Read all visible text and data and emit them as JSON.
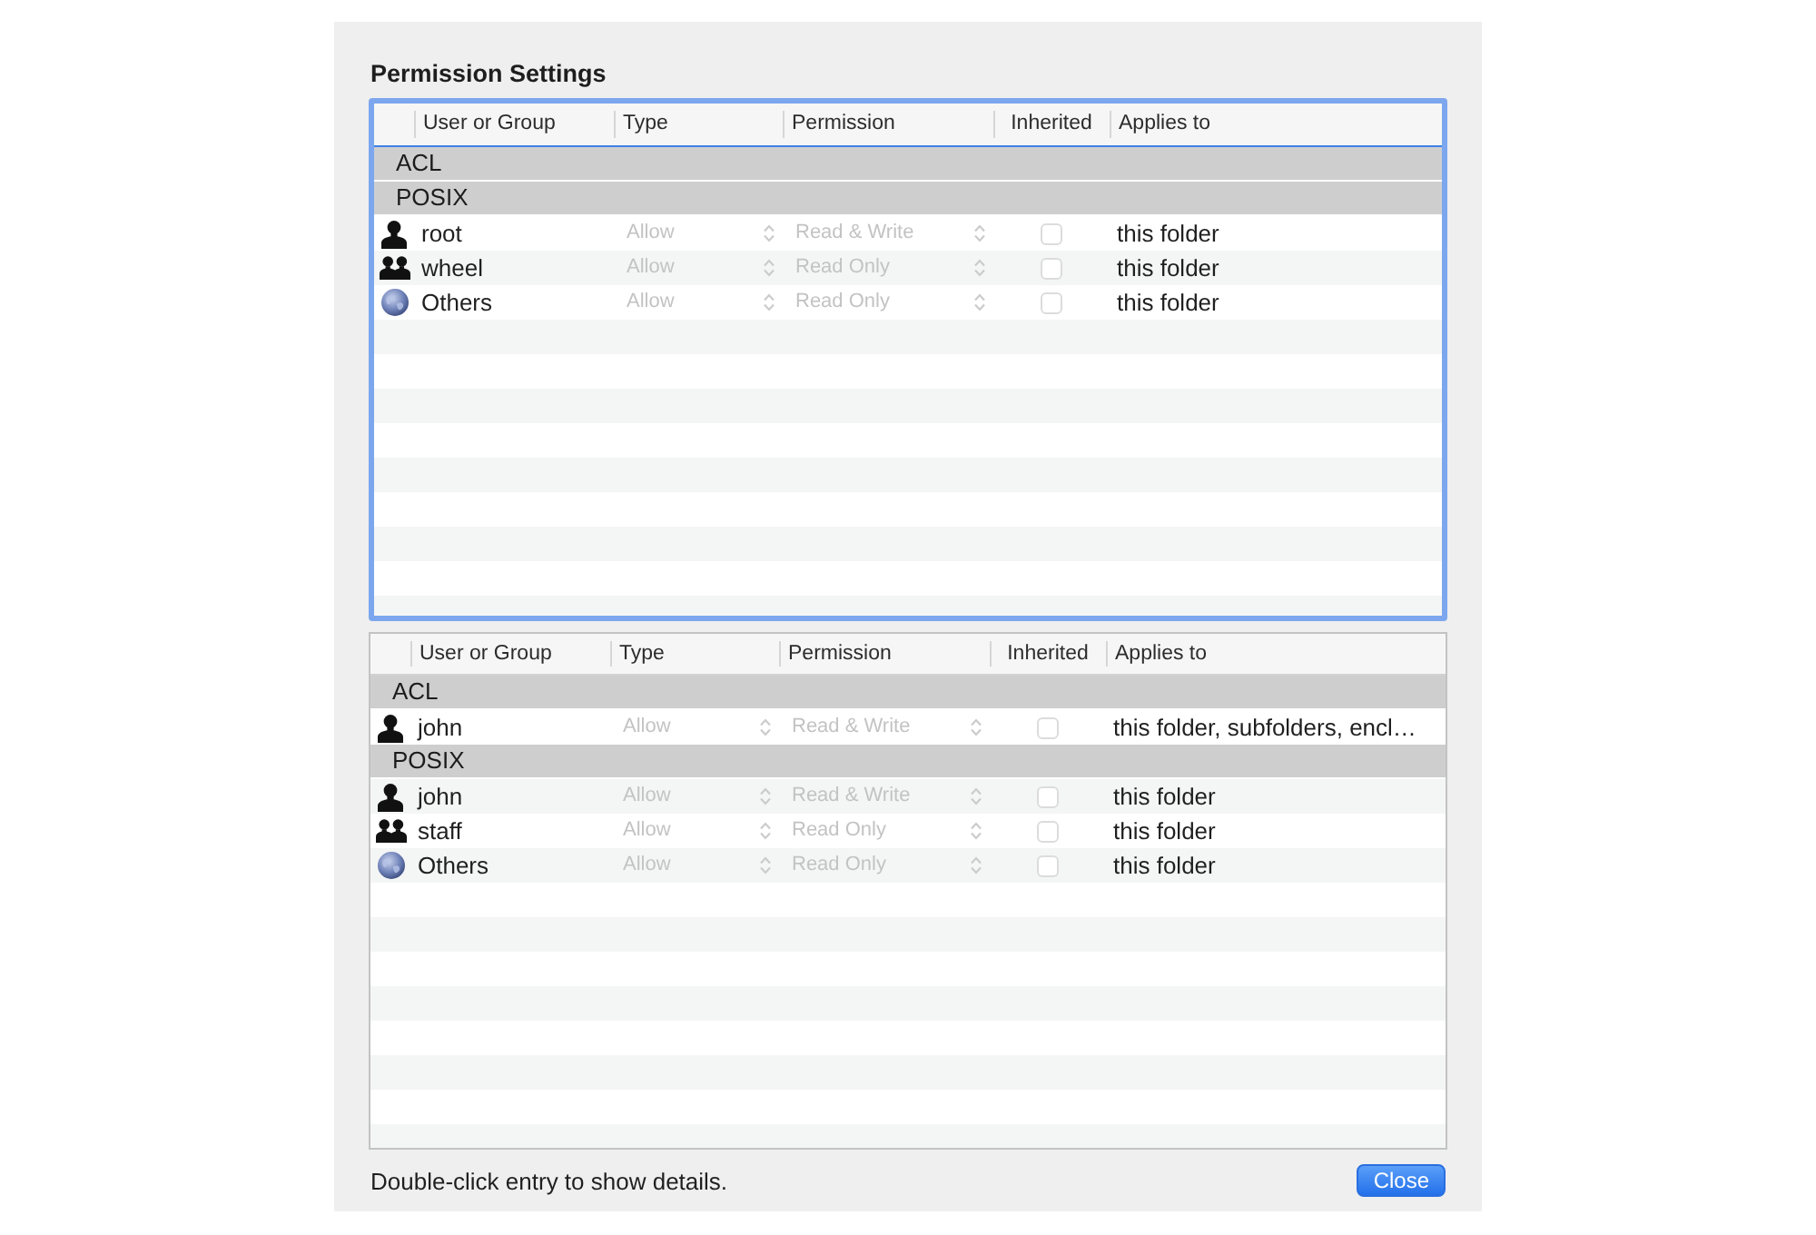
{
  "dialog": {
    "title": "Permission Settings"
  },
  "tables": [
    {
      "focused": true,
      "columns": [
        "User or Group",
        "Type",
        "Permission",
        "Inherited",
        "Applies to"
      ],
      "sections": [
        {
          "name": "ACL"
        },
        {
          "name": "POSIX",
          "entries": [
            {
              "kind": "user",
              "name": "root",
              "type": "Allow",
              "permission": "Read & Write",
              "inherited": false,
              "disabled": true,
              "applies_to": "this folder"
            },
            {
              "kind": "group",
              "name": "wheel",
              "type": "Allow",
              "permission": "Read Only",
              "inherited": false,
              "disabled": true,
              "applies_to": "this folder"
            },
            {
              "kind": "everyone",
              "name": "Others",
              "type": "Allow",
              "permission": "Read Only",
              "inherited": false,
              "disabled": true,
              "applies_to": "this folder"
            }
          ]
        }
      ]
    },
    {
      "focused": false,
      "columns": [
        "User or Group",
        "Type",
        "Permission",
        "Inherited",
        "Applies to"
      ],
      "sections": [
        {
          "name": "ACL",
          "entries": [
            {
              "kind": "user",
              "name": "john",
              "type": "Allow",
              "permission": "Read & Write",
              "inherited": false,
              "disabled": true,
              "applies_to": "this folder, subfolders, encl…"
            }
          ]
        },
        {
          "name": "POSIX",
          "entries": [
            {
              "kind": "user",
              "name": "john",
              "type": "Allow",
              "permission": "Read & Write",
              "inherited": false,
              "disabled": true,
              "applies_to": "this folder"
            },
            {
              "kind": "group",
              "name": "staff",
              "type": "Allow",
              "permission": "Read Only",
              "inherited": false,
              "disabled": true,
              "applies_to": "this folder"
            },
            {
              "kind": "everyone",
              "name": "Others",
              "type": "Allow",
              "permission": "Read Only",
              "inherited": false,
              "disabled": true,
              "applies_to": "this folder"
            }
          ]
        }
      ]
    }
  ],
  "footer": {
    "hint": "Double-click entry to show details."
  },
  "buttons": [
    {
      "label": "Close",
      "default": true
    }
  ]
}
